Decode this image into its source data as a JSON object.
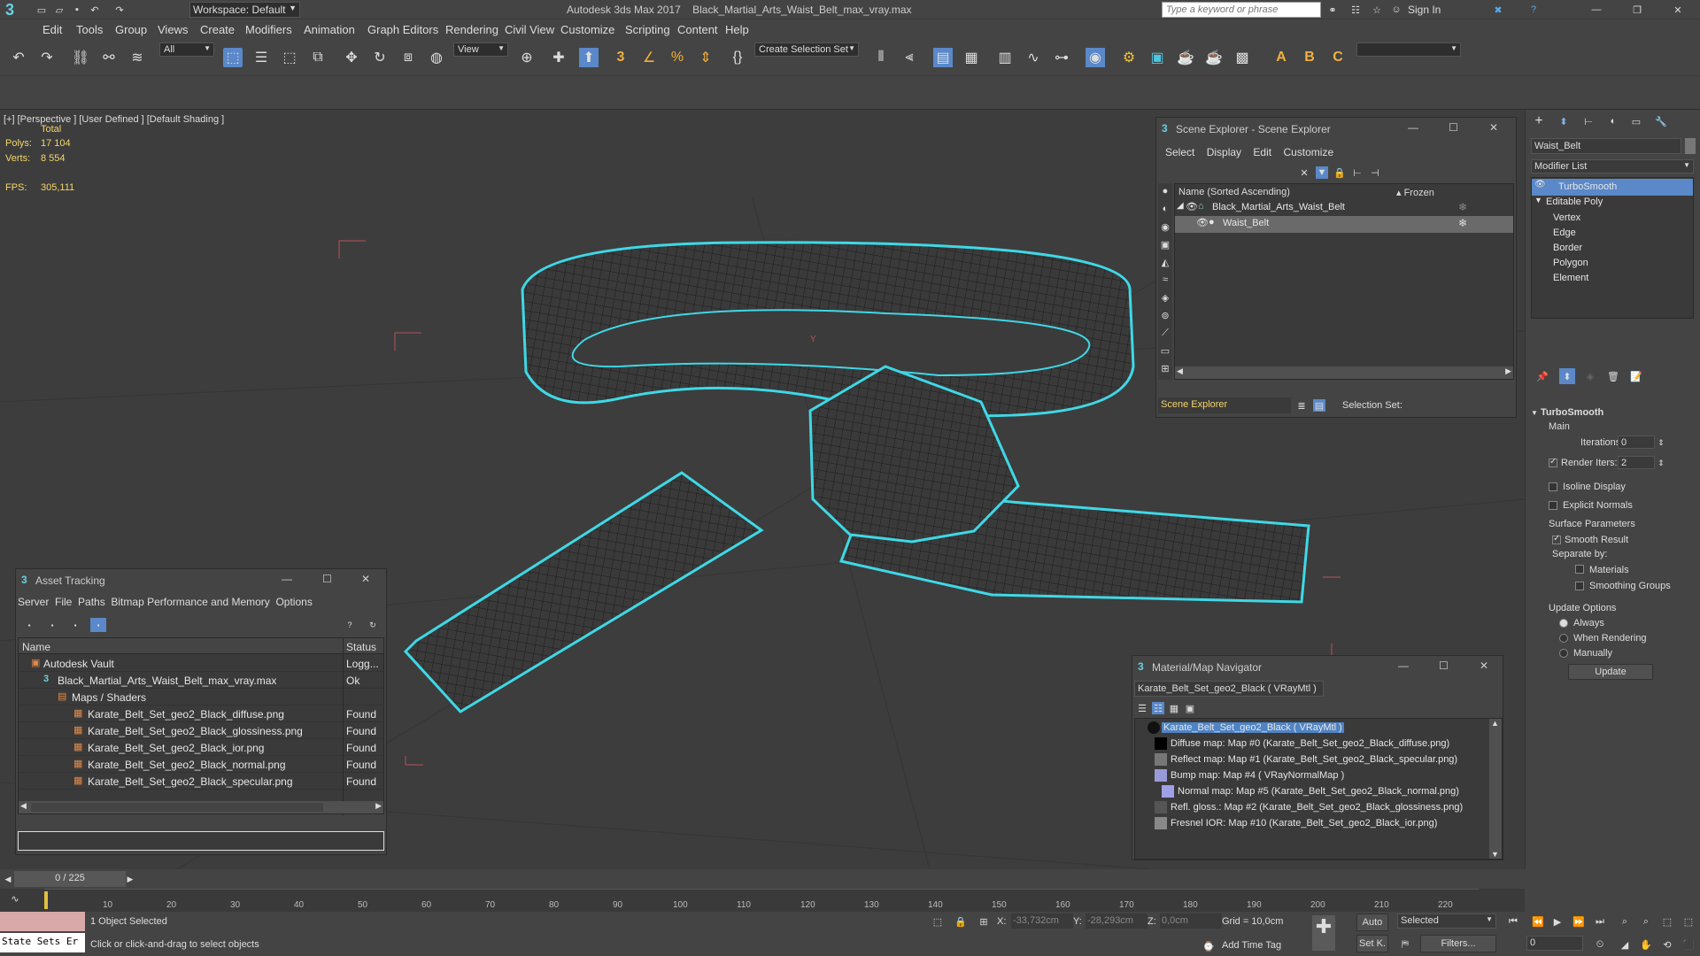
{
  "app": {
    "logo": "3",
    "workspace_label": "Workspace: Default",
    "title": "Autodesk 3ds Max 2017",
    "filename": "Black_Martial_Arts_Waist_Belt_max_vray.max",
    "search_placeholder": "Type a keyword or phrase",
    "sign_in": "Sign In"
  },
  "menu": [
    "Edit",
    "Tools",
    "Group",
    "Views",
    "Create",
    "Modifiers",
    "Animation",
    "Graph Editors",
    "Rendering",
    "Civil View",
    "Customize",
    "Scripting",
    "Content",
    "Help"
  ],
  "toolbar": {
    "filter_value": "All",
    "refcoord_value": "View",
    "selection_set_label": "Create Selection Set"
  },
  "viewport": {
    "label_plus": "[+]",
    "label_view": "[Perspective ]",
    "label_mode": "[User Defined ]",
    "label_shading": "[Default Shading ]",
    "stats_total": "Total",
    "polys_label": "Polys:",
    "polys_value": "17 104",
    "verts_label": "Verts:",
    "verts_value": "8 554",
    "fps_label": "FPS:",
    "fps_value": "305,111"
  },
  "scene_explorer": {
    "title": "Scene Explorer - Scene Explorer",
    "menu": [
      "Select",
      "Display",
      "Edit",
      "Customize"
    ],
    "col_name": "Name (Sorted Ascending)",
    "col_frozen": "▴ Frozen",
    "rows": [
      "Black_Martial_Arts_Waist_Belt",
      "Waist_Belt"
    ],
    "footer_label": "Scene Explorer",
    "selection_set_label": "Selection Set:"
  },
  "command_panel": {
    "object_name": "Waist_Belt",
    "modifier_list_label": "Modifier List",
    "stack": [
      "TurboSmooth",
      "Editable Poly",
      "Vertex",
      "Edge",
      "Border",
      "Polygon",
      "Element"
    ],
    "rollout_title": "TurboSmooth",
    "main_label": "Main",
    "iterations_label": "Iterations:",
    "iterations_value": "0",
    "render_iters_label": "Render Iters:",
    "render_iters_value": "2",
    "isoline_label": "Isoline Display",
    "explicit_normals_label": "Explicit Normals",
    "surface_params_label": "Surface Parameters",
    "smooth_result_label": "Smooth Result",
    "separate_by_label": "Separate by:",
    "materials_label": "Materials",
    "smoothing_groups_label": "Smoothing Groups",
    "update_options_label": "Update Options",
    "always_label": "Always",
    "when_rendering_label": "When Rendering",
    "manually_label": "Manually",
    "update_button": "Update"
  },
  "asset_tracking": {
    "title": "Asset Tracking",
    "menu": [
      "Server",
      "File",
      "Paths",
      "Bitmap Performance and Memory",
      "Options"
    ],
    "col_name": "Name",
    "col_status": "Status",
    "rows": [
      {
        "name": "Autodesk Vault",
        "status": "Logg..."
      },
      {
        "name": "Black_Martial_Arts_Waist_Belt_max_vray.max",
        "status": "Ok"
      },
      {
        "name": "Maps / Shaders",
        "status": ""
      },
      {
        "name": "Karate_Belt_Set_geo2_Black_diffuse.png",
        "status": "Found"
      },
      {
        "name": "Karate_Belt_Set_geo2_Black_glossiness.png",
        "status": "Found"
      },
      {
        "name": "Karate_Belt_Set_geo2_Black_ior.png",
        "status": "Found"
      },
      {
        "name": "Karate_Belt_Set_geo2_Black_normal.png",
        "status": "Found"
      },
      {
        "name": "Karate_Belt_Set_geo2_Black_specular.png",
        "status": "Found"
      }
    ]
  },
  "material_navigator": {
    "title": "Material/Map Navigator",
    "current": "Karate_Belt_Set_geo2_Black  ( VRayMtl )",
    "items": [
      "Karate_Belt_Set_geo2_Black  ( VRayMtl )",
      "Diffuse map: Map #0 (Karate_Belt_Set_geo2_Black_diffuse.png)",
      "Reflect map: Map #1 (Karate_Belt_Set_geo2_Black_specular.png)",
      "Bump map: Map #4  ( VRayNormalMap )",
      "Normal map: Map #5 (Karate_Belt_Set_geo2_Black_normal.png)",
      "Refl. gloss.: Map #2 (Karate_Belt_Set_geo2_Black_glossiness.png)",
      "Fresnel IOR: Map #10 (Karate_Belt_Set_geo2_Black_ior.png)"
    ]
  },
  "timeline": {
    "frame_label": "0 / 225",
    "ticks": [
      "10",
      "20",
      "30",
      "40",
      "50",
      "60",
      "70",
      "80",
      "90",
      "100",
      "110",
      "120",
      "130",
      "140",
      "150",
      "160",
      "170",
      "180",
      "190",
      "200",
      "210",
      "220"
    ]
  },
  "status": {
    "state_sets": "State Sets Er",
    "selected_count": "1 Object Selected",
    "prompt": "Click or click-and-drag to select objects",
    "x_label": "X:",
    "x_value": "-33,732cm",
    "y_label": "Y:",
    "y_value": "-28,293cm",
    "z_label": "Z:",
    "z_value": "0,0cm",
    "grid": "Grid = 10,0cm",
    "add_time_tag": "Add Time Tag",
    "auto": "Auto",
    "set_k": "Set K.",
    "selected_dropdown": "Selected",
    "filters": "Filters...",
    "frame_value": "0"
  },
  "colors": {
    "selection_outline": "#3fd8e6",
    "wire": "#1a1a1a",
    "highlight_row": "#4f84c4"
  }
}
